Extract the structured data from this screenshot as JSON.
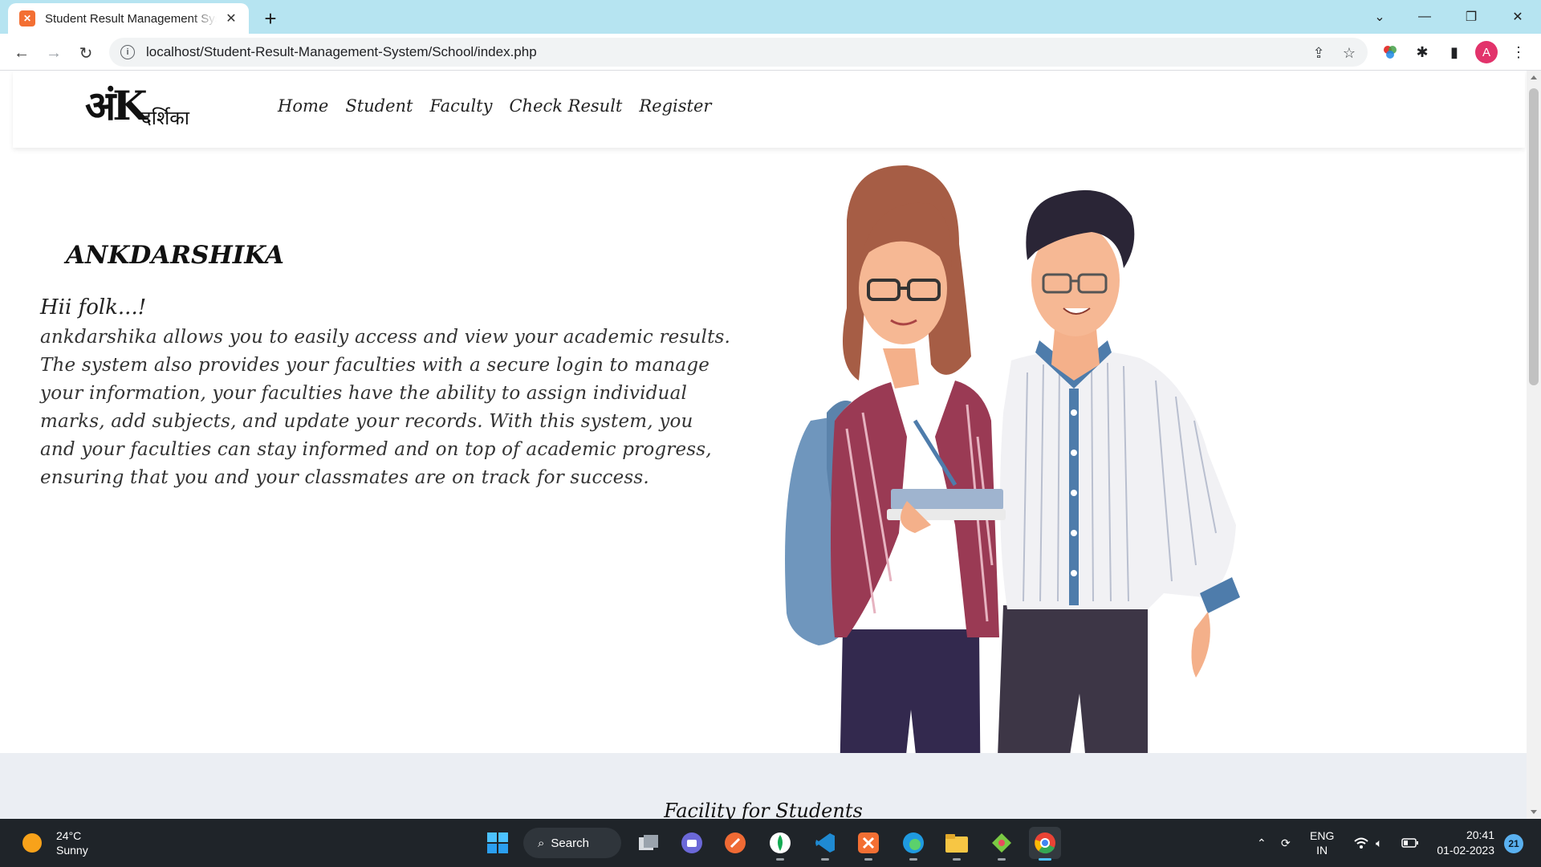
{
  "browser": {
    "tab_title": "Student Result Management System",
    "tab_favicon": "xampp-icon",
    "url": "localhost/Student-Result-Management-System/School/index.php",
    "profile_initial": "A"
  },
  "site": {
    "logo_main": "अंK",
    "logo_sub": "दर्शिका",
    "nav": [
      "Home",
      "Student",
      "Faculty",
      "Check Result",
      "Register"
    ],
    "hero_title": "ANKDARSHIKA",
    "hero_greeting": "Hii folk...!",
    "hero_lines": [
      "ankdarshika allows you to easily access and view your academic results.",
      "The system also provides your faculties with a secure login to manage",
      "your information, your faculties have the ability to assign individual",
      "marks, add subjects, and update your records. With this system, you",
      "and your faculties can stay informed and on top of academic progress,",
      "ensuring that you and your classmates are on track for success."
    ],
    "facility_title": "Facility for Students"
  },
  "taskbar": {
    "temperature": "24°C",
    "condition": "Sunny",
    "search_label": "Search",
    "language": "ENG",
    "region": "IN",
    "time": "20:41",
    "date": "01-02-2023",
    "notification_count": "21"
  }
}
